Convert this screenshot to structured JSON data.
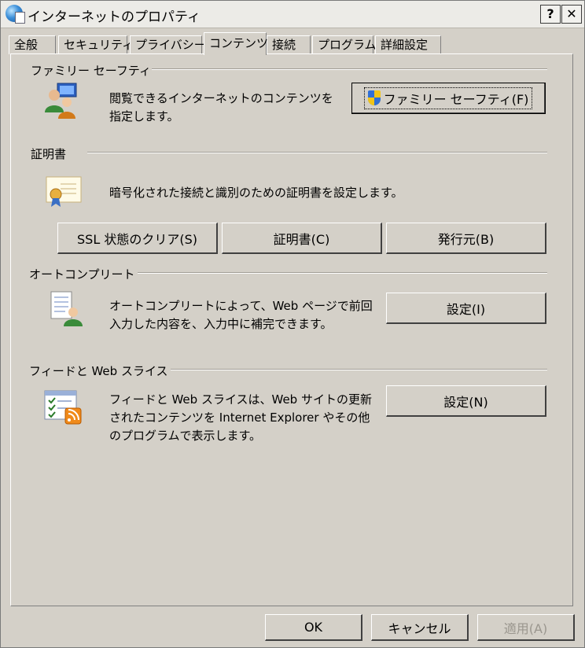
{
  "window": {
    "title": "インターネットのプロパティ",
    "help_label": "?",
    "close_label": "✕"
  },
  "tabs": [
    {
      "label": "全般"
    },
    {
      "label": "セキュリティ"
    },
    {
      "label": "プライバシー"
    },
    {
      "label": "コンテンツ",
      "active": true
    },
    {
      "label": "接続"
    },
    {
      "label": "プログラム"
    },
    {
      "label": "詳細設定"
    }
  ],
  "family_safety": {
    "header": "ファミリー セーフティ",
    "description": "閲覧できるインターネットのコンテンツを指定します。",
    "button_label": "ファミリー セーフティ(F)",
    "icon": "family-users-icon"
  },
  "certificates": {
    "header": "証明書",
    "description": "暗号化された接続と識別のための証明書を設定します。",
    "clear_ssl_label": "SSL 状態のクリア(S)",
    "certificates_label": "証明書(C)",
    "publishers_label": "発行元(B)",
    "icon": "certificate-icon"
  },
  "autocomplete": {
    "header": "オートコンプリート",
    "description": "オートコンプリートによって、Web ページで前回入力した内容を、入力中に補完できます。",
    "settings_label": "設定(I)",
    "icon": "autocomplete-form-icon"
  },
  "feeds": {
    "header": "フィードと Web スライス",
    "description": "フィードと Web スライスは、Web サイトの更新されたコンテンツを Internet Explorer やその他のプログラムで表示します。",
    "settings_label": "設定(N)",
    "icon": "rss-feed-icon"
  },
  "footer": {
    "ok_label": "OK",
    "cancel_label": "キャンセル",
    "apply_label": "適用(A)"
  }
}
